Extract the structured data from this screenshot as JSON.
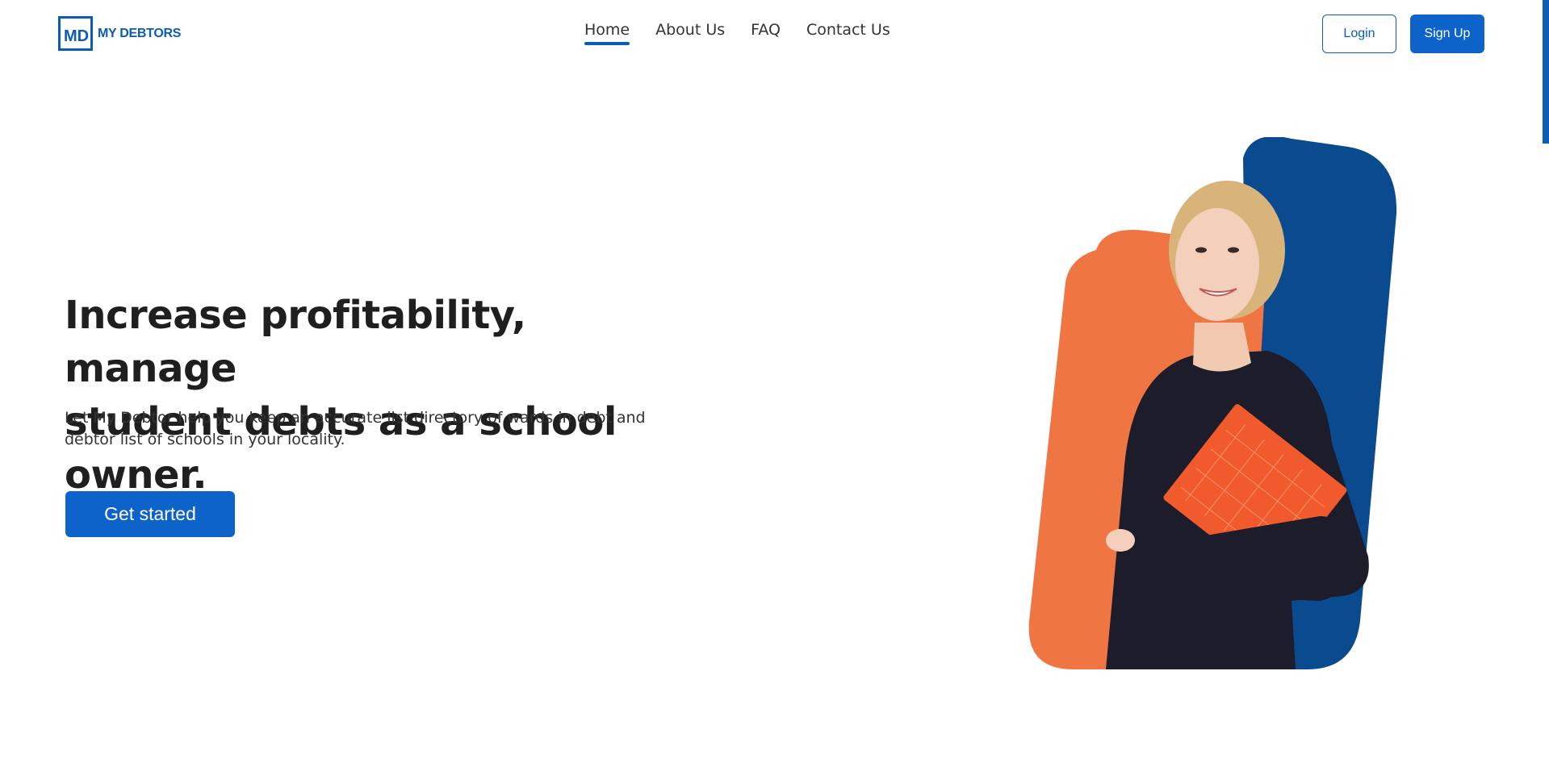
{
  "brand": {
    "logo_initials": "MD",
    "name": "MY DEBTORS"
  },
  "nav": {
    "items": [
      {
        "label": "Home",
        "active": true
      },
      {
        "label": "About Us",
        "active": false
      },
      {
        "label": "FAQ",
        "active": false
      },
      {
        "label": "Contact Us",
        "active": false
      }
    ]
  },
  "auth": {
    "login_label": "Login",
    "signup_label": "Sign Up"
  },
  "hero": {
    "title_line1": "Increase profitability, manage",
    "title_line2": "student debts as a school owner.",
    "subtitle": "Let My Debtor help you keep an accurate list directory of wards in debt and debtor list of schools in your locality.",
    "cta_label": "Get started",
    "image": "woman-holding-orange-folder"
  },
  "colors": {
    "brand_blue": "#0c5cb5",
    "button_blue": "#0d63c9",
    "navy_panel": "#0a4a8e",
    "orange_panel": "#ef7542"
  }
}
